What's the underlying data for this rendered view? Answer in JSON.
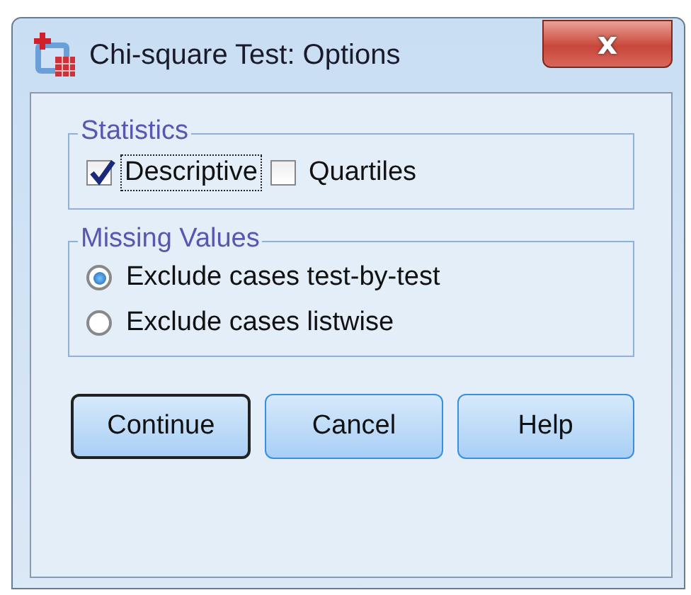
{
  "window": {
    "title": "Chi-square Test: Options",
    "close_label": "x"
  },
  "statistics": {
    "title": "Statistics",
    "options": [
      {
        "label": "Descriptive",
        "checked": true,
        "focused": true
      },
      {
        "label": "Quartiles",
        "checked": false,
        "focused": false
      }
    ]
  },
  "missing_values": {
    "title": "Missing Values",
    "options": [
      {
        "label": "Exclude cases test-by-test",
        "selected": true
      },
      {
        "label": "Exclude cases listwise",
        "selected": false
      }
    ]
  },
  "buttons": [
    {
      "label": "Continue",
      "default": true
    },
    {
      "label": "Cancel",
      "default": false
    },
    {
      "label": "Help",
      "default": false
    }
  ]
}
